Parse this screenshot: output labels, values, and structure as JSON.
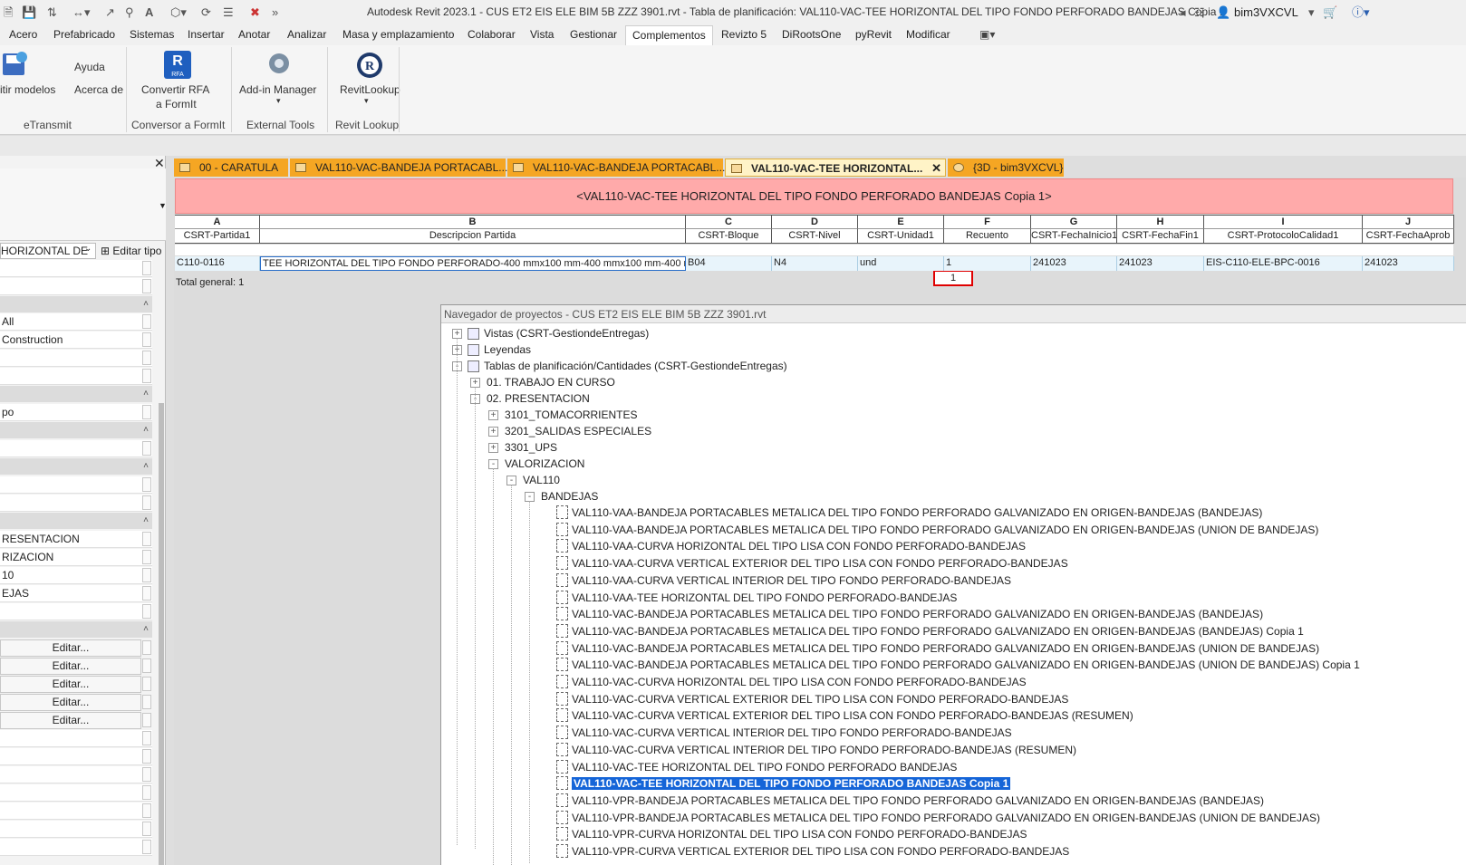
{
  "title_bar": {
    "app_title": "Autodesk Revit 2023.1 - CUS ET2 EIS ELE BIM 5B ZZZ 3901.rvt - Tabla de planificación: VAL110-VAC-TEE HORIZONTAL DEL TIPO FONDO PERFORADO BANDEJAS Copia 1",
    "user": "bim3VXCVL"
  },
  "menu": [
    "Acero",
    "Prefabricado",
    "Sistemas",
    "Insertar",
    "Anotar",
    "Analizar",
    "Masa y emplazamiento",
    "Colaborar",
    "Vista",
    "Gestionar",
    "Complementos",
    "Revizto 5",
    "DiRootsOne",
    "pyRevit",
    "Modificar"
  ],
  "ribbon": {
    "transmit_label": "itir modelos",
    "help_label": "Ayuda",
    "about_label": "Acerca de",
    "convert_label1": "Convertir RFA",
    "convert_label2": "a FormIt",
    "addin_label": "Add-in Manager",
    "lookup_label": "RevitLookup",
    "panels": [
      "eTransmit",
      "Conversor a FormIt",
      "External Tools",
      "Revit Lookup"
    ],
    "rfa_text": "RFA"
  },
  "properties": {
    "type_selector": "HORIZONTAL DE",
    "edit_type": "Editar tipo",
    "rows": [
      "All",
      "Construction",
      "po",
      "RESENTACION",
      "RIZACION",
      "10",
      "EJAS"
    ],
    "edit_label": "Editar..."
  },
  "tabs": [
    "00 - CARATULA",
    "VAL110-VAC-BANDEJA PORTACABL...",
    "VAL110-VAC-BANDEJA PORTACABL...",
    "VAL110-VAC-TEE HORIZONTAL...",
    "{3D - bim3VXCVL}"
  ],
  "schedule": {
    "title": "<VAL110-VAC-TEE HORIZONTAL DEL TIPO FONDO PERFORADO BANDEJAS Copia 1>",
    "letters": [
      "A",
      "B",
      "C",
      "D",
      "E",
      "F",
      "G",
      "H",
      "I",
      "J"
    ],
    "headers": [
      "CSRT-Partida1",
      "Descripcion Partida",
      "CSRT-Bloque",
      "CSRT-Nivel",
      "CSRT-Unidad1",
      "Recuento",
      "CSRT-FechaInicio1",
      "CSRT-FechaFin1",
      "CSRT-ProtocoloCalidad1",
      "CSRT-FechaAprob"
    ],
    "row": [
      "C110-0116",
      "TEE HORIZONTAL DEL TIPO FONDO PERFORADO-400 mmx100 mm-400 mmx100 mm-400 mmx",
      "B04",
      "N4",
      "und",
      "1",
      "241023",
      "241023",
      "EIS-C110-ELE-BPC-0016",
      "241023"
    ],
    "total_label": "Total general: 1",
    "total_value": "1"
  },
  "browser": {
    "title": "Navegador de proyectos - CUS ET2 EIS ELE BIM 5B ZZZ 3901.rvt",
    "nodes": [
      "Vistas (CSRT-GestiondeEntregas)",
      "Leyendas",
      "Tablas de planificación/Cantidades (CSRT-GestiondeEntregas)",
      "01. TRABAJO EN CURSO",
      "02. PRESENTACION",
      "3101_TOMACORRIENTES",
      "3201_SALIDAS ESPECIALES",
      "3301_UPS",
      "VALORIZACION",
      "VAL110",
      "BANDEJAS"
    ],
    "leaves": [
      "VAL110-VAA-BANDEJA PORTACABLES METALICA DEL TIPO FONDO PERFORADO GALVANIZADO EN ORIGEN-BANDEJAS (BANDEJAS)",
      "VAL110-VAA-BANDEJA PORTACABLES METALICA DEL TIPO FONDO PERFORADO GALVANIZADO EN ORIGEN-BANDEJAS (UNION DE BANDEJAS)",
      "VAL110-VAA-CURVA HORIZONTAL DEL TIPO LISA CON FONDO PERFORADO-BANDEJAS",
      "VAL110-VAA-CURVA VERTICAL EXTERIOR DEL TIPO LISA CON FONDO PERFORADO-BANDEJAS",
      "VAL110-VAA-CURVA VERTICAL INTERIOR DEL TIPO FONDO PERFORADO-BANDEJAS",
      "VAL110-VAA-TEE HORIZONTAL DEL TIPO FONDO PERFORADO-BANDEJAS",
      "VAL110-VAC-BANDEJA PORTACABLES METALICA DEL TIPO FONDO PERFORADO GALVANIZADO EN ORIGEN-BANDEJAS (BANDEJAS)",
      "VAL110-VAC-BANDEJA PORTACABLES METALICA DEL TIPO FONDO PERFORADO GALVANIZADO EN ORIGEN-BANDEJAS (BANDEJAS) Copia 1",
      "VAL110-VAC-BANDEJA PORTACABLES METALICA DEL TIPO FONDO PERFORADO GALVANIZADO EN ORIGEN-BANDEJAS (UNION DE BANDEJAS)",
      "VAL110-VAC-BANDEJA PORTACABLES METALICA DEL TIPO FONDO PERFORADO GALVANIZADO EN ORIGEN-BANDEJAS (UNION DE BANDEJAS) Copia 1",
      "VAL110-VAC-CURVA HORIZONTAL DEL TIPO LISA CON FONDO PERFORADO-BANDEJAS",
      "VAL110-VAC-CURVA VERTICAL EXTERIOR DEL TIPO LISA CON FONDO PERFORADO-BANDEJAS",
      "VAL110-VAC-CURVA VERTICAL EXTERIOR DEL TIPO LISA CON FONDO PERFORADO-BANDEJAS (RESUMEN)",
      "VAL110-VAC-CURVA VERTICAL INTERIOR DEL TIPO FONDO PERFORADO-BANDEJAS",
      "VAL110-VAC-CURVA VERTICAL INTERIOR DEL TIPO FONDO PERFORADO-BANDEJAS (RESUMEN)",
      "VAL110-VAC-TEE HORIZONTAL DEL TIPO FONDO PERFORADO BANDEJAS",
      "VAL110-VAC-TEE HORIZONTAL DEL TIPO FONDO PERFORADO BANDEJAS Copia 1",
      "VAL110-VPR-BANDEJA PORTACABLES METALICA DEL TIPO FONDO PERFORADO GALVANIZADO EN ORIGEN-BANDEJAS (BANDEJAS)",
      "VAL110-VPR-BANDEJA PORTACABLES METALICA DEL TIPO FONDO PERFORADO GALVANIZADO EN ORIGEN-BANDEJAS (UNION DE BANDEJAS)",
      "VAL110-VPR-CURVA HORIZONTAL DEL TIPO LISA CON FONDO PERFORADO-BANDEJAS",
      "VAL110-VPR-CURVA VERTICAL EXTERIOR DEL TIPO LISA CON FONDO PERFORADO-BANDEJAS"
    ],
    "selected_index": 16
  },
  "colors": {
    "schedule_title_bg": "#ffaaaa",
    "active_tab": "#fff3c7",
    "tab_bg": "#f5a623",
    "selection": "#1565d8",
    "highlight_box": "#e00000"
  }
}
